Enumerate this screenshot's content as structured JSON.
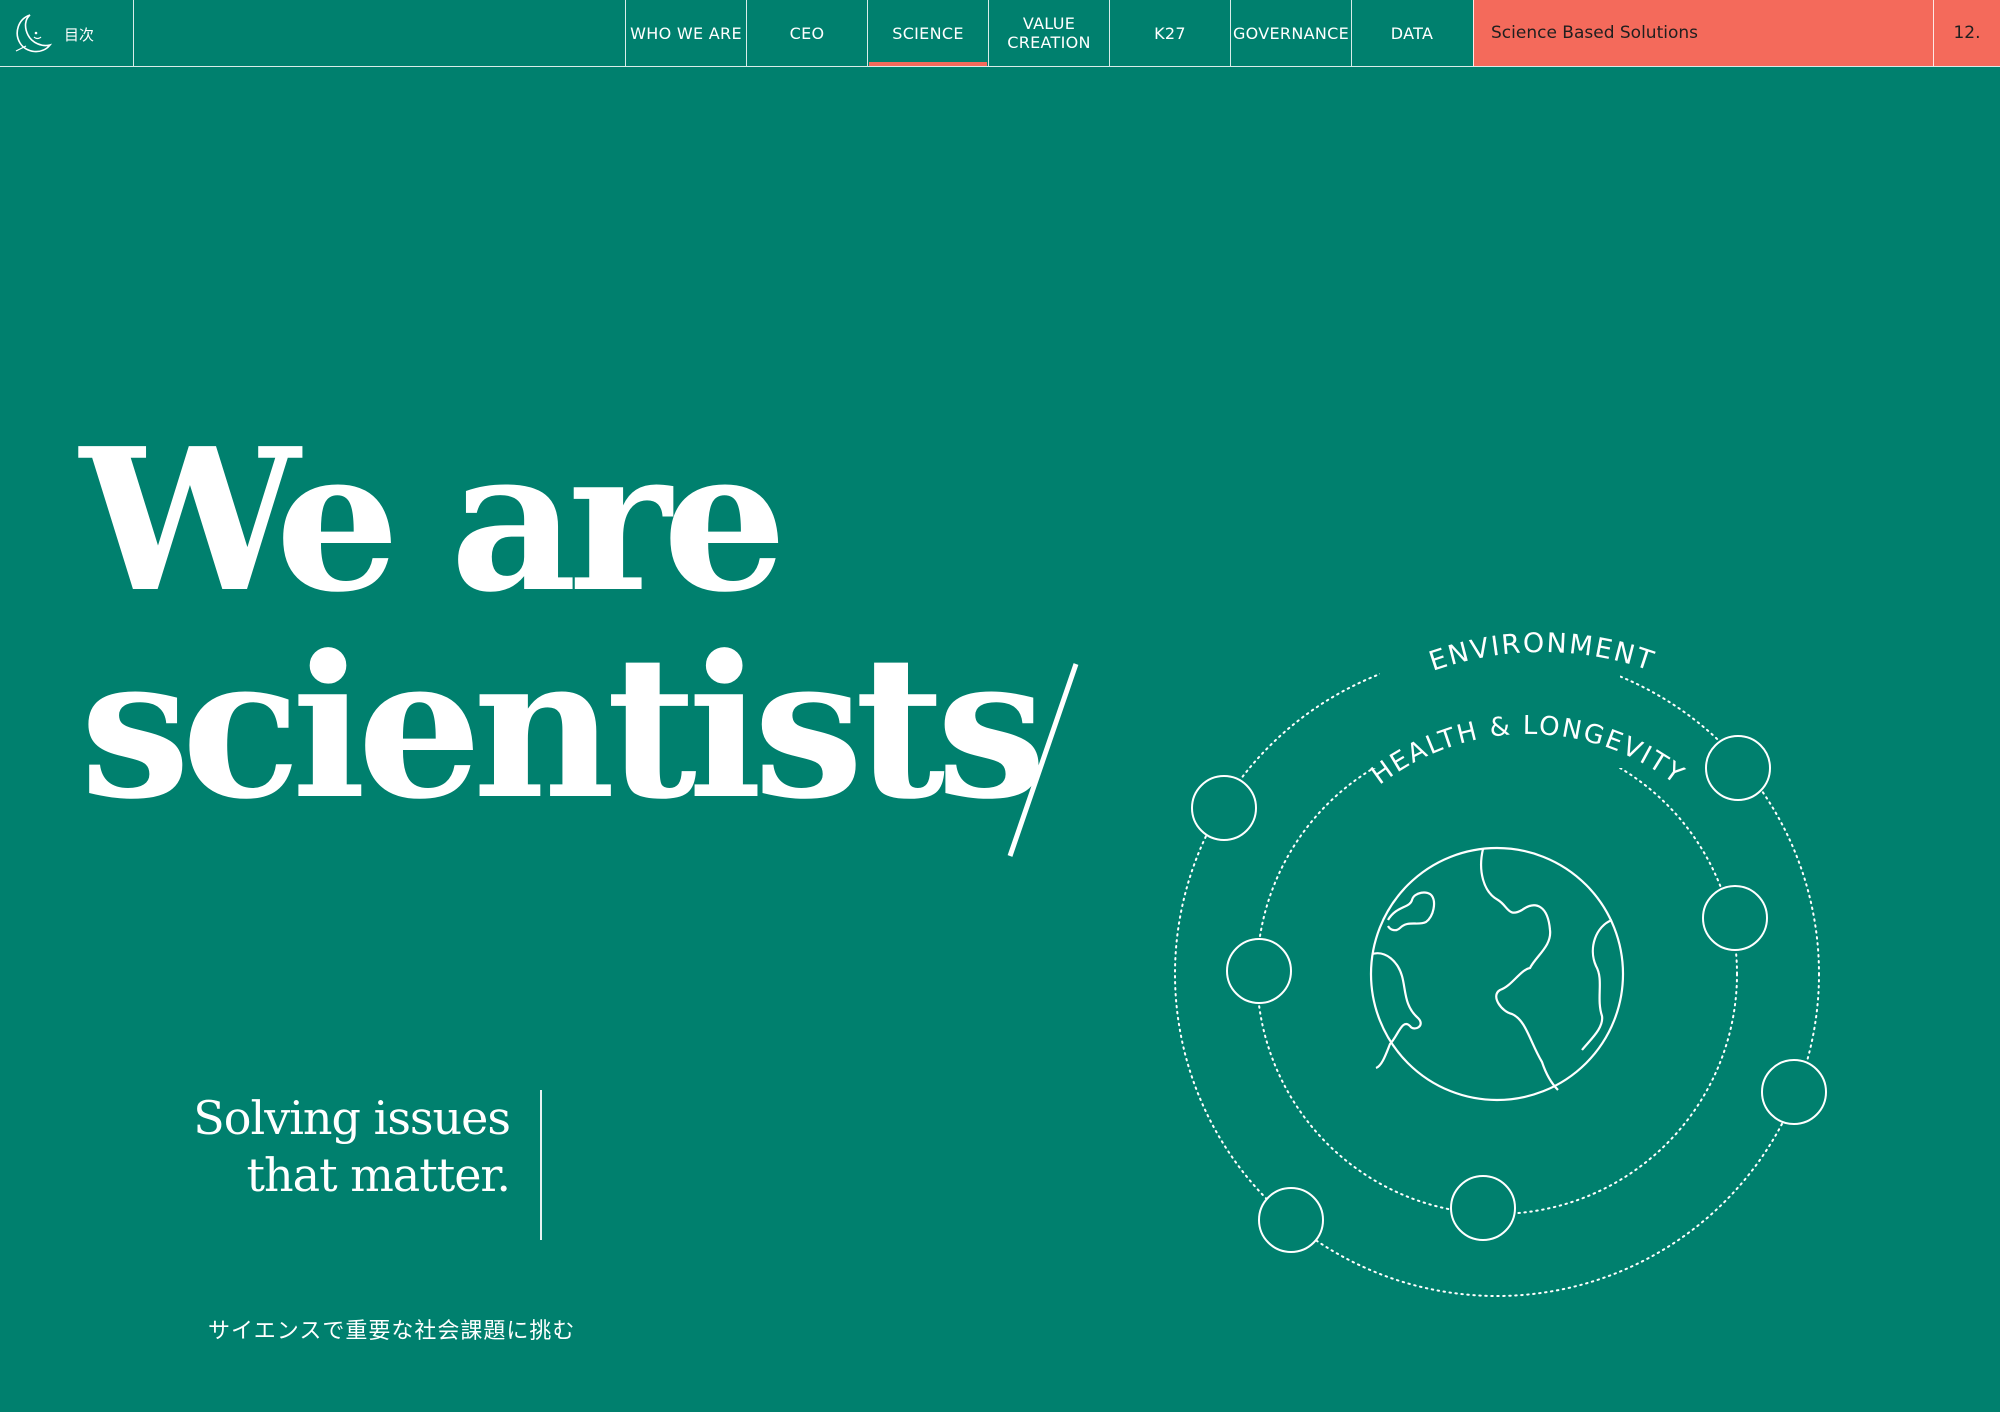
{
  "nav": {
    "toc_label": "目次",
    "tabs": [
      {
        "label": "WHO WE ARE",
        "active": false
      },
      {
        "label": "CEO",
        "active": false
      },
      {
        "label": "SCIENCE",
        "active": true
      },
      {
        "label": "VALUE\nCREATION",
        "active": false
      },
      {
        "label": "K27",
        "active": false
      },
      {
        "label": "GOVERNANCE",
        "active": false
      },
      {
        "label": "DATA",
        "active": false
      }
    ],
    "section_title": "Science Based Solutions",
    "page_number": "12."
  },
  "hero": {
    "headline_line1": "We are",
    "headline_line2": "scientists",
    "subhead_line1": "Solving issues",
    "subhead_line2": "that matter.",
    "japanese_tagline": "サイエンスで重要な社会課題に挑む"
  },
  "diagram": {
    "outer_label": "ENVIRONMENT",
    "inner_label": "HEALTH & LONGEVITY",
    "icon": "globe-icon"
  },
  "colors": {
    "background": "#00806e",
    "accent": "#f46a5b",
    "text": "#ffffff"
  }
}
